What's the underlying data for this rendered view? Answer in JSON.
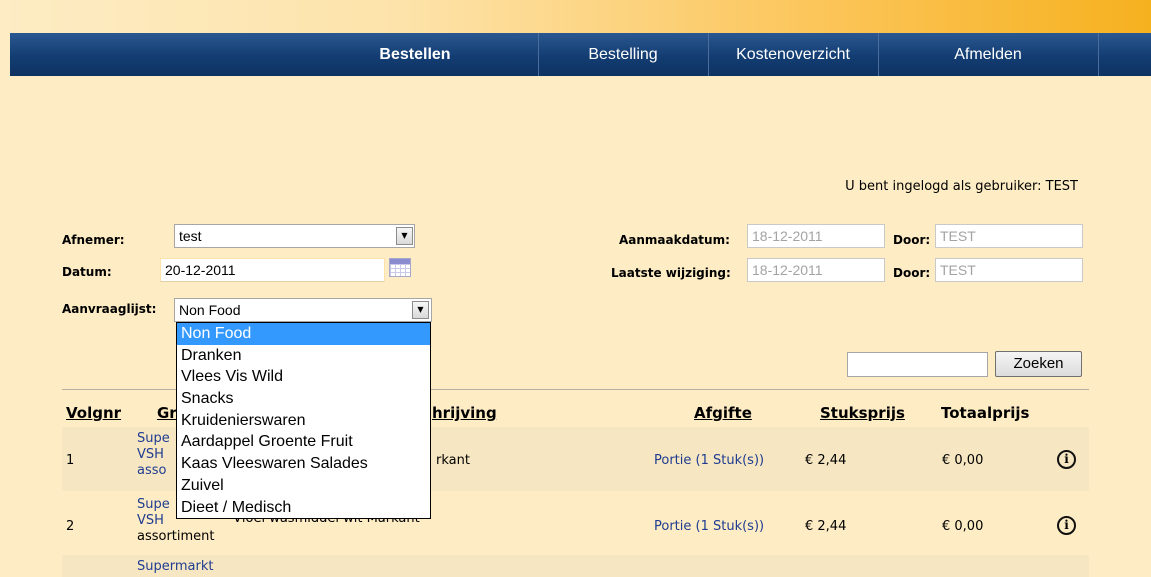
{
  "nav": {
    "items": [
      "Bestellen",
      "Bestelling",
      "Kostenoverzicht",
      "Afmelden"
    ]
  },
  "logged_in": "U bent ingelogd als gebruiker: TEST",
  "form": {
    "afnemer_label": "Afnemer:",
    "afnemer_value": "test",
    "datum_label": "Datum:",
    "datum_value": "20-12-2011",
    "aanvraaglijst_label": "Aanvraaglijst:",
    "aanvraaglijst_value": "Non Food",
    "aanmaakdatum_label": "Aanmaakdatum:",
    "aanmaakdatum_value": "18-12-2011",
    "laatste_wijziging_label": "Laatste wijziging:",
    "laatste_wijziging_value": "18-12-2011",
    "door_label": "Door:",
    "door_value_1": "TEST",
    "door_value_2": "TEST"
  },
  "search": {
    "value": "",
    "button": "Zoeken"
  },
  "dropdown": {
    "options": [
      "Non Food",
      "Dranken",
      "Vlees Vis Wild",
      "Snacks",
      "Kruidenierswaren",
      "Aardappel Groente Fruit",
      "Kaas Vleeswaren Salades",
      "Zuivel",
      "Dieet / Medisch"
    ],
    "selected": "Non Food"
  },
  "table": {
    "headers": {
      "volgnr": "Volgnr",
      "groep": "Gr",
      "omschrijving": "hrijving",
      "afgifte": "Afgifte",
      "stuksprijs": "Stuksprijs",
      "totaalprijs": "Totaalprijs"
    },
    "rows": [
      {
        "volgnr": "1",
        "groep_1": "Supe",
        "groep_2": "VSH",
        "groep_3": "asso",
        "omschrijving": "rkant",
        "afgifte": "Portie (1 Stuk(s))",
        "stuksprijs": "€ 2,44",
        "totaalprijs": "€ 0,00"
      },
      {
        "volgnr": "2",
        "groep_1": "Supe",
        "groep_2": "VSH",
        "groep_3": "assortiment",
        "omschrijving": "Vloei wasmiddel wit Markant",
        "afgifte": "Portie (1 Stuk(s))",
        "stuksprijs": "€ 2,44",
        "totaalprijs": "€ 0,00"
      },
      {
        "volgnr": "",
        "groep_1": "Supermarkt",
        "groep_2": "",
        "groep_3": "",
        "omschrijving": "",
        "afgifte": "",
        "stuksprijs": "",
        "totaalprijs": ""
      }
    ]
  },
  "colors": {
    "nav_bg": "#133d72",
    "page_bg": "#fdecc4",
    "link": "#1f3c91",
    "highlight": "#3399ff",
    "row_alt": "#f6e7c2"
  }
}
